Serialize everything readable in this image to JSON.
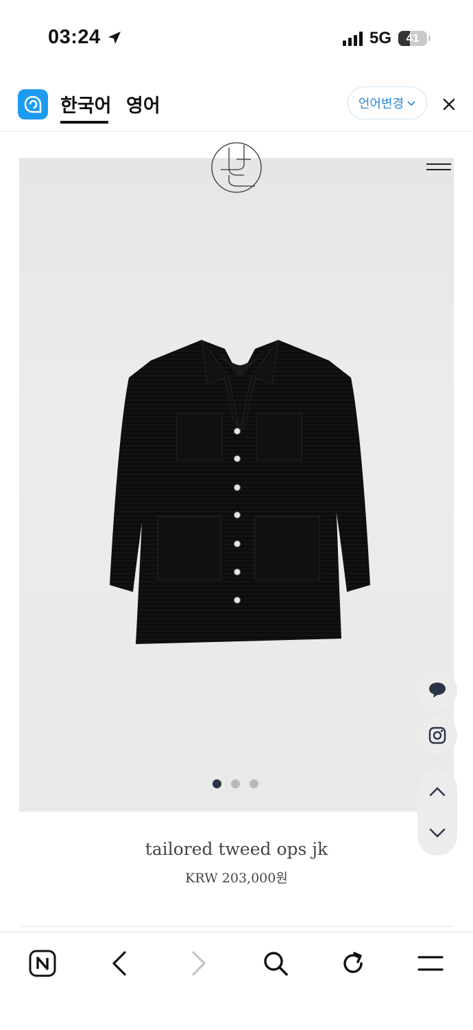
{
  "status_bar": {
    "time": "03:24",
    "network": "5G",
    "battery": "41",
    "battery_level": 0.41,
    "icons": [
      "location-arrow-icon",
      "signal-icon",
      "battery-icon"
    ]
  },
  "translation_bar": {
    "tabs": [
      {
        "label": "한국어",
        "active": true
      },
      {
        "label": "영어",
        "active": false
      }
    ],
    "language_change_label": "언어변경",
    "icons": [
      "papago-logo-icon",
      "chevron-down-icon",
      "close-icon"
    ],
    "accent_color": "#1d9bf0"
  },
  "product": {
    "name": "tailored tweed ops jk",
    "price": "KRW 203,000원",
    "image_icons": [
      "brand-logo-icon",
      "menu-icon",
      "jacket-image"
    ],
    "carousel": {
      "count": 3,
      "active_index": 0
    },
    "active_dot_color": "#2a3347"
  },
  "side_buttons": [
    "chat-icon",
    "instagram-icon",
    "arrow-up-icon",
    "arrow-down-icon"
  ],
  "browser_toolbar": {
    "buttons": [
      "naver-home-icon",
      "back-icon",
      "forward-icon",
      "search-icon",
      "reload-icon",
      "menu-icon"
    ],
    "forward_enabled": false
  }
}
